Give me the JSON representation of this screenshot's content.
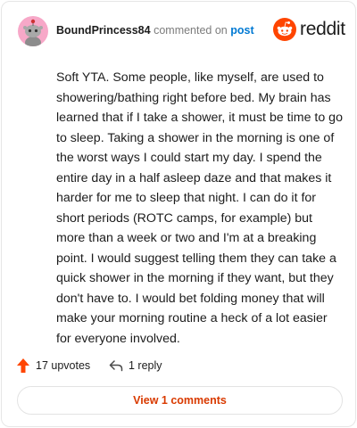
{
  "comment": {
    "username": "BoundPrincess84",
    "action_text": "commented on",
    "post_link": "post",
    "body": "Soft YTA. Some people, like myself, are used to showering/bathing right before bed. My brain has learned that if I take a shower, it must be time to go to sleep. Taking a shower in the morning is one of the worst ways I could start my day. I spend the entire day in a half asleep daze and that makes it harder for me to sleep that night. I can do it for short periods (ROTC camps, for example) but more than a week or two and I'm at a breaking point. I would suggest telling them they can take a quick shower in the morning if they want, but they don't have to. I would bet folding money that will make your morning routine a heck of a lot easier for everyone involved."
  },
  "brand": {
    "name": "reddit",
    "icon": "reddit-snoo-icon",
    "color": "#ff4500"
  },
  "actions": {
    "upvotes_label": "17 upvotes",
    "upvote_icon": "upvote-arrow-icon",
    "upvote_color": "#ff4500",
    "reply_label": "1 reply",
    "reply_icon": "reply-arrow-icon"
  },
  "footer": {
    "view_comments_label": "View 1 comments",
    "accent": "#d93a00"
  }
}
